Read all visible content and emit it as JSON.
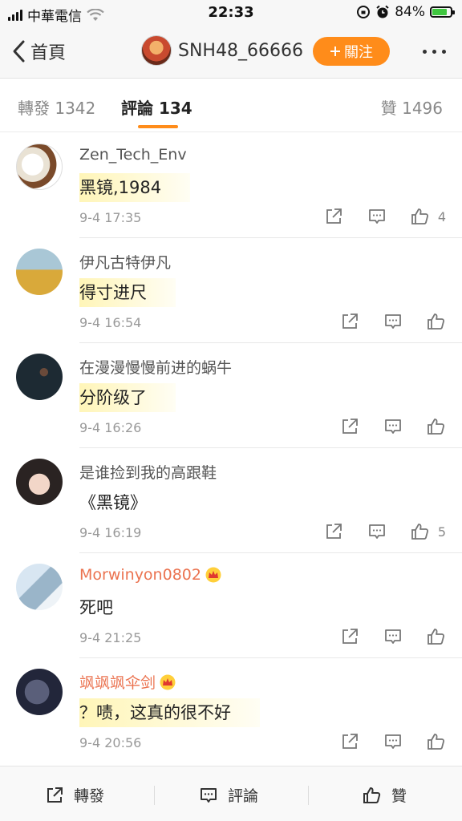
{
  "status_bar": {
    "carrier": "中華電信",
    "time": "22:33",
    "battery_percent": "84%",
    "battery_level": 0.84,
    "battery_color": "#3fc63f"
  },
  "nav": {
    "back_label": "首頁",
    "account_name": "SNH48_66666",
    "follow_label": "關注",
    "accent_color": "#ff8c1a"
  },
  "tabs": {
    "repost": "轉發 1342",
    "comments": "評論 134",
    "likes": "贊 1496"
  },
  "comments": [
    {
      "user": "Zen_Tech_Env",
      "text": "黑镜,1984",
      "time": "9-4 17:35",
      "likes": "4",
      "highlight": true,
      "vip": false
    },
    {
      "user": "伊凡古特伊凡",
      "text": "得寸进尺",
      "time": "9-4 16:54",
      "likes": "",
      "highlight": true,
      "vip": false
    },
    {
      "user": "在漫漫慢慢前进的蜗牛",
      "text": "分阶级了",
      "time": "9-4 16:26",
      "likes": "",
      "highlight": true,
      "vip": false
    },
    {
      "user": "是谁捡到我的高跟鞋",
      "text": "《黑镜》",
      "time": "9-4 16:19",
      "likes": "5",
      "highlight": false,
      "vip": false
    },
    {
      "user": "Morwinyon0802",
      "text": "死吧",
      "time": "9-4 21:25",
      "likes": "",
      "highlight": false,
      "vip": true
    },
    {
      "user": "飒飒飒伞剑",
      "text": "？啧，这真的很不好",
      "time": "9-4 20:56",
      "likes": "",
      "highlight": true,
      "vip": true
    }
  ],
  "bottom_bar": {
    "repost": "轉發",
    "comment": "評論",
    "like": "贊"
  }
}
